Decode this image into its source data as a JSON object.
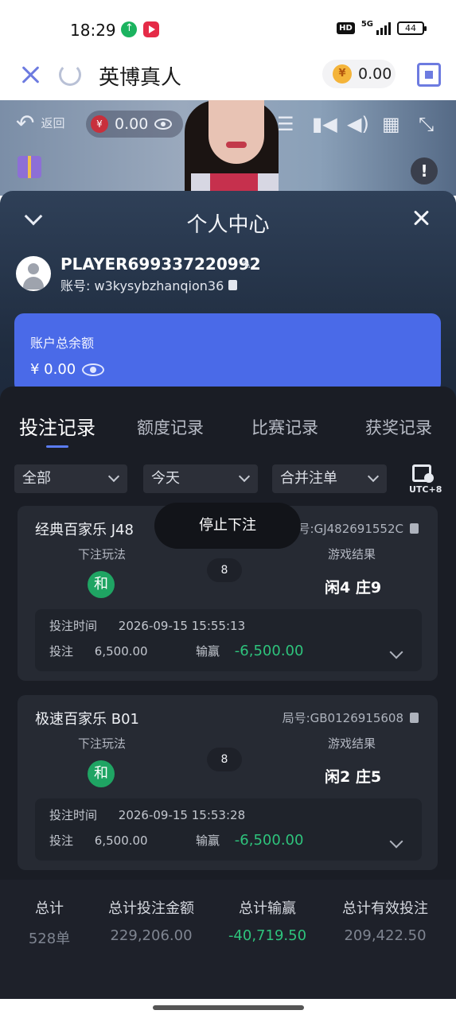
{
  "status_bar": {
    "time": "18:29",
    "hd": "HD",
    "network": "5G",
    "battery": "44"
  },
  "header": {
    "title": "英博真人",
    "balance": "0.00",
    "coin_symbol": "¥"
  },
  "video": {
    "back_label": "返回",
    "wallet_amount": "0.00",
    "yen": "¥"
  },
  "panel": {
    "title": "个人中心",
    "player_name": "PLAYER699337220992",
    "account": "账号: w3kysybzhanqion36",
    "balance_label": "账户总余额",
    "balance_amount": "¥ 0.00"
  },
  "tabs": [
    "投注记录",
    "额度记录",
    "比赛记录",
    "获奖记录"
  ],
  "filters": {
    "type": "全部",
    "date": "今天",
    "merge": "合并注单",
    "timezone": "UTC+8"
  },
  "toast": "停止下注",
  "labels": {
    "bet_play": "下注玩法",
    "game_result": "游戏结果",
    "bet_time": "投注时间",
    "bet": "投注",
    "win_loss": "输赢"
  },
  "records": [
    {
      "title": "经典百家乐 J48",
      "round": "局号:GJ482691552C",
      "play": "和",
      "count": "8",
      "result": "闲4 庄9",
      "time": "2026-09-15 15:55:13",
      "bet": "6,500.00",
      "win_loss": "-6,500.00"
    },
    {
      "title": "极速百家乐 B01",
      "round": "局号:GB0126915608",
      "play": "和",
      "count": "8",
      "result": "闲2 庄5",
      "time": "2026-09-15 15:53:28",
      "bet": "6,500.00",
      "win_loss": "-6,500.00"
    }
  ],
  "summary": {
    "total_label": "总计",
    "total_value": "528单",
    "bet_amount_label": "总计投注金额",
    "bet_amount_value": "229,206.00",
    "win_loss_label": "总计输赢",
    "win_loss_value": "-40,719.50",
    "valid_bet_label": "总计有效投注",
    "valid_bet_value": "209,422.50"
  },
  "colors": {
    "accent": "#5b7cf2",
    "balance_card": "#4a6ae8",
    "negative_green": "#2ec37c",
    "tie_badge": "#1fa463"
  }
}
